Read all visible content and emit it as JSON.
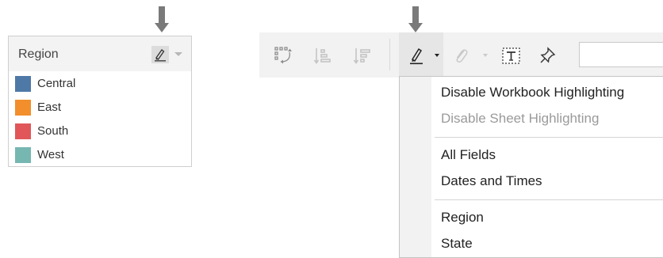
{
  "legend": {
    "title": "Region",
    "highlight_icon": "highlighter-pen-icon",
    "items": [
      {
        "label": "Central",
        "color": "#4e79a7"
      },
      {
        "label": "East",
        "color": "#f28e2b"
      },
      {
        "label": "South",
        "color": "#e15759"
      },
      {
        "label": "West",
        "color": "#76b7b2"
      }
    ]
  },
  "toolbar": {
    "icons": [
      "swap-rows-columns-icon",
      "sort-ascending-icon",
      "sort-descending-icon",
      "highlighter-pen-icon",
      "paperclip-icon",
      "text-label-icon",
      "pin-icon"
    ]
  },
  "highlight_menu": {
    "items": [
      {
        "label": "Disable Workbook Highlighting",
        "enabled": true
      },
      {
        "label": "Disable Sheet Highlighting",
        "enabled": false
      },
      {
        "label": "All Fields",
        "enabled": true
      },
      {
        "label": "Dates and Times",
        "enabled": true
      },
      {
        "label": "Region",
        "enabled": true
      },
      {
        "label": "State",
        "enabled": true
      }
    ]
  }
}
